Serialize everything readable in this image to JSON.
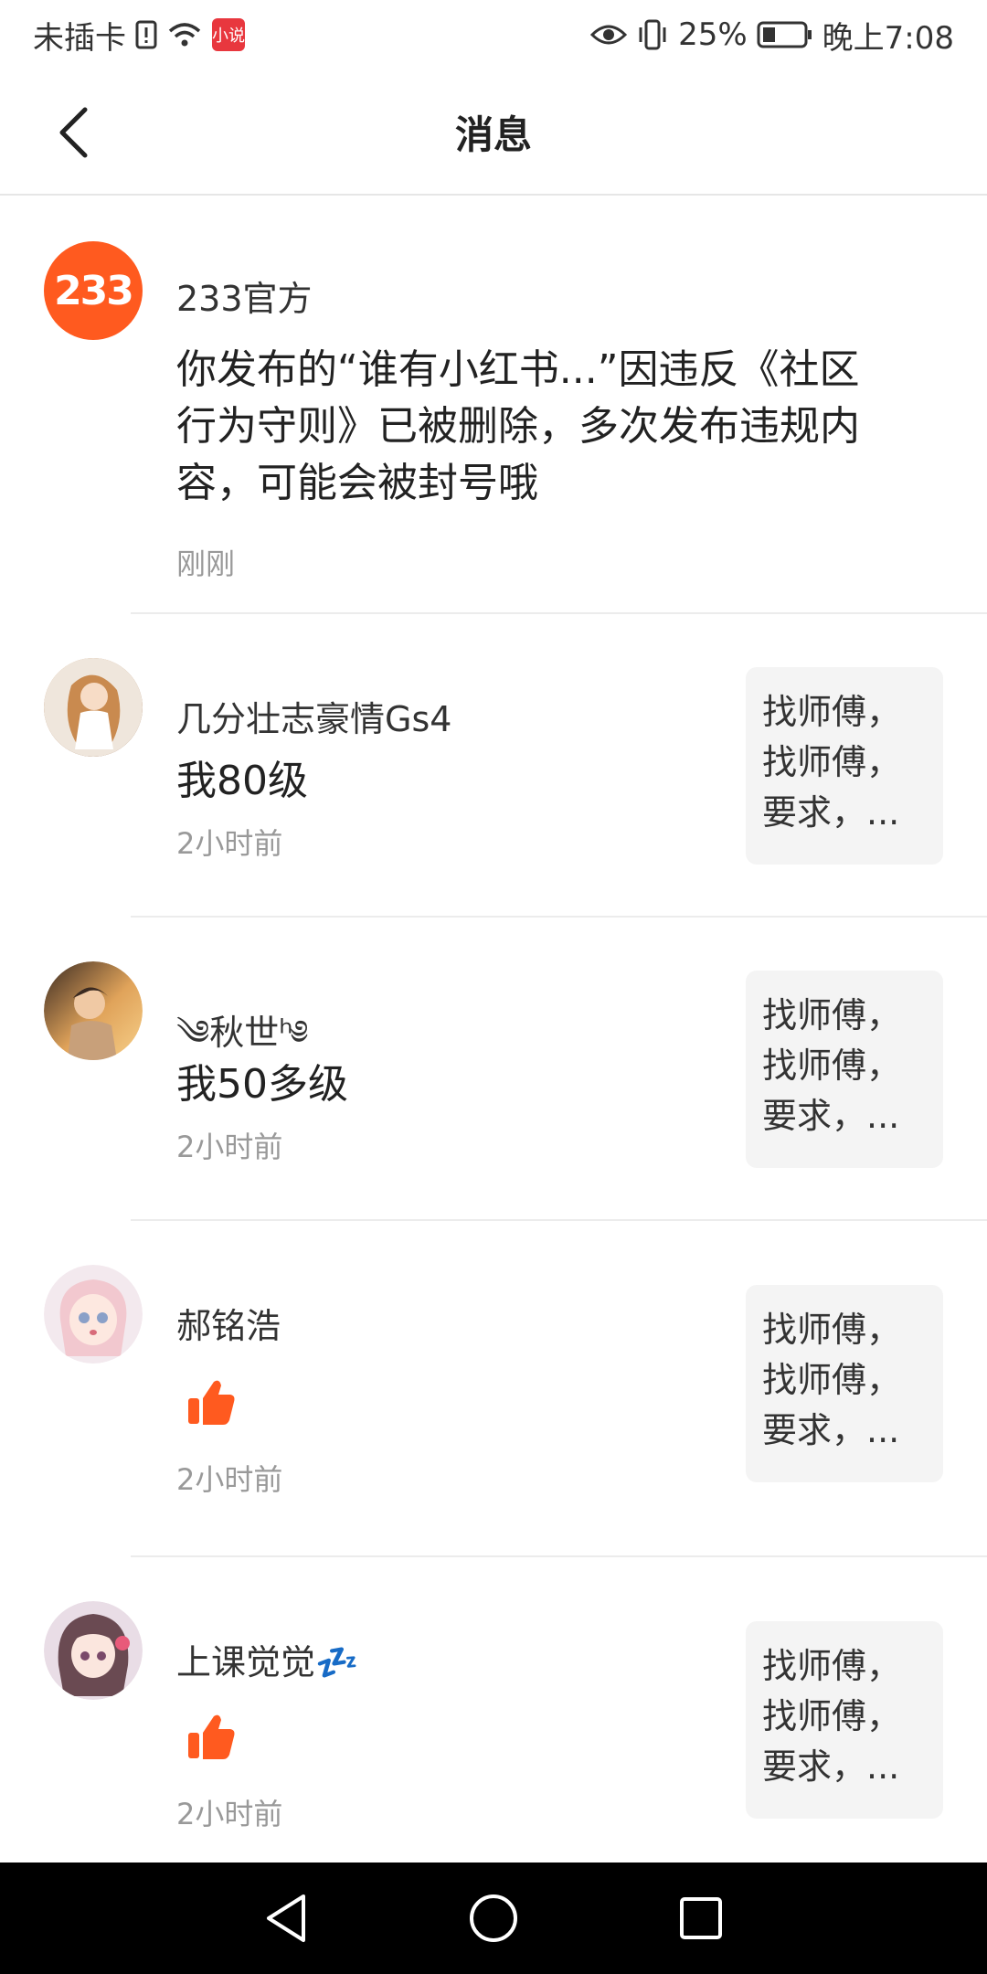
{
  "status_bar": {
    "carrier": "未插卡",
    "app_badge": "小说",
    "battery_percent": "25%",
    "clock": "晚上7:08"
  },
  "header": {
    "title": "消息"
  },
  "messages": [
    {
      "sender": "233官方",
      "avatar_text": "233",
      "text": "你发布的“谁有小红书...”因违反《社区行为守则》已被删除，多次发布违规内容，可能会被封号哦",
      "time": "刚刚"
    },
    {
      "sender": "几分壮志豪情Gs4",
      "text": "我80级",
      "time": "2小时前",
      "preview": "找师傅，找师傅，要求，..."
    },
    {
      "sender": "༄秋世ʰ༅",
      "text": "我50多级",
      "time": "2小时前",
      "preview": "找师傅，找师傅，要求，..."
    },
    {
      "sender": "郝铭浩",
      "time": "2小时前",
      "preview": "找师傅，找师傅，要求，...",
      "reaction": "thumbs-up-icon"
    },
    {
      "sender": "上课觉觉💤",
      "time": "2小时前",
      "preview": "找师傅，找师傅，要求，...",
      "reaction": "thumbs-up-icon"
    }
  ],
  "colors": {
    "accent": "#ff5a1f",
    "preview_bg": "#f4f4f4",
    "time_text": "#999999"
  }
}
